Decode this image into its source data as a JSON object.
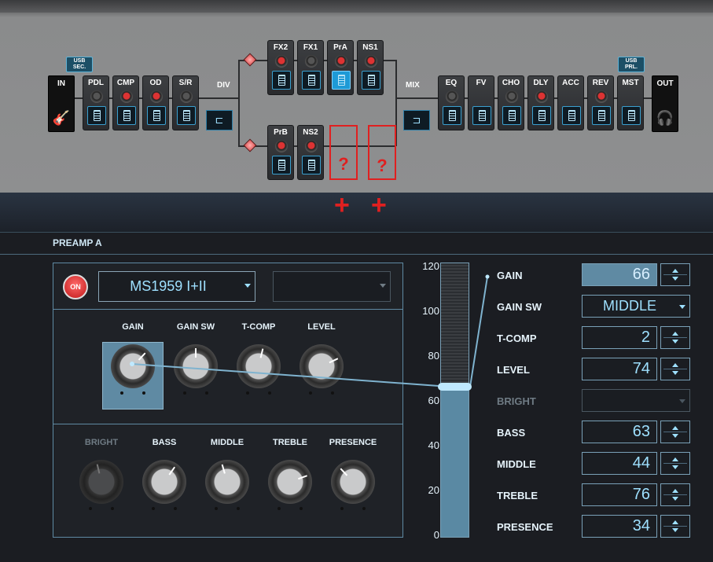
{
  "chain": {
    "in_label": "IN",
    "out_label": "OUT",
    "div_label": "DIV",
    "mix_label": "MIX",
    "usb_sec": "USB\nSEC.",
    "usb_prl": "USB\nPRL.",
    "blocks_pre": [
      {
        "label": "PDL",
        "knob": "grey"
      },
      {
        "label": "CMP",
        "knob": "red"
      },
      {
        "label": "OD",
        "knob": "red"
      },
      {
        "label": "S/R",
        "knob": "grey"
      }
    ],
    "blocks_a": [
      {
        "label": "FX2",
        "knob": "red"
      },
      {
        "label": "FX1",
        "knob": "grey"
      },
      {
        "label": "PrA",
        "knob": "red",
        "active": true
      },
      {
        "label": "NS1",
        "knob": "red"
      }
    ],
    "blocks_b": [
      {
        "label": "PrB",
        "knob": "red"
      },
      {
        "label": "NS2",
        "knob": "red"
      }
    ],
    "blocks_post": [
      {
        "label": "EQ",
        "knob": "grey"
      },
      {
        "label": "FV",
        "knob": "none"
      },
      {
        "label": "CHO",
        "knob": "grey"
      },
      {
        "label": "DLY",
        "knob": "red"
      },
      {
        "label": "ACC",
        "knob": "none"
      },
      {
        "label": "REV",
        "knob": "red"
      },
      {
        "label": "MST",
        "knob": "none"
      }
    ],
    "question_marks": [
      "?",
      "?"
    ],
    "plus_marks": [
      "+",
      "+"
    ]
  },
  "preamp": {
    "title": "PREAMP A",
    "on_label": "ON",
    "type": "MS1959 I+II",
    "secondary_select": "",
    "knobs_top": [
      {
        "label": "GAIN",
        "value": 66
      },
      {
        "label": "GAIN SW",
        "value": 50
      },
      {
        "label": "T-COMP",
        "value": 55
      },
      {
        "label": "LEVEL",
        "value": 74
      }
    ],
    "knobs_bottom": [
      {
        "label": "BRIGHT",
        "value": 45,
        "disabled": true
      },
      {
        "label": "BASS",
        "value": 63
      },
      {
        "label": "MIDDLE",
        "value": 44
      },
      {
        "label": "TREBLE",
        "value": 76
      },
      {
        "label": "PRESENCE",
        "value": 34
      }
    ],
    "slider": {
      "value": 66,
      "ticks": [
        "120",
        "100",
        "80",
        "60",
        "40",
        "20",
        "0"
      ],
      "max": 120
    },
    "params": [
      {
        "label": "GAIN",
        "value": "66",
        "kind": "num",
        "highlight": true
      },
      {
        "label": "GAIN SW",
        "value": "MIDDLE",
        "kind": "select"
      },
      {
        "label": "T-COMP",
        "value": "2",
        "kind": "num"
      },
      {
        "label": "LEVEL",
        "value": "74",
        "kind": "num"
      },
      {
        "label": "BRIGHT",
        "value": "",
        "kind": "select",
        "disabled": true
      },
      {
        "label": "BASS",
        "value": "63",
        "kind": "num"
      },
      {
        "label": "MIDDLE",
        "value": "44",
        "kind": "num"
      },
      {
        "label": "TREBLE",
        "value": "76",
        "kind": "num"
      },
      {
        "label": "PRESENCE",
        "value": "34",
        "kind": "num"
      }
    ]
  }
}
